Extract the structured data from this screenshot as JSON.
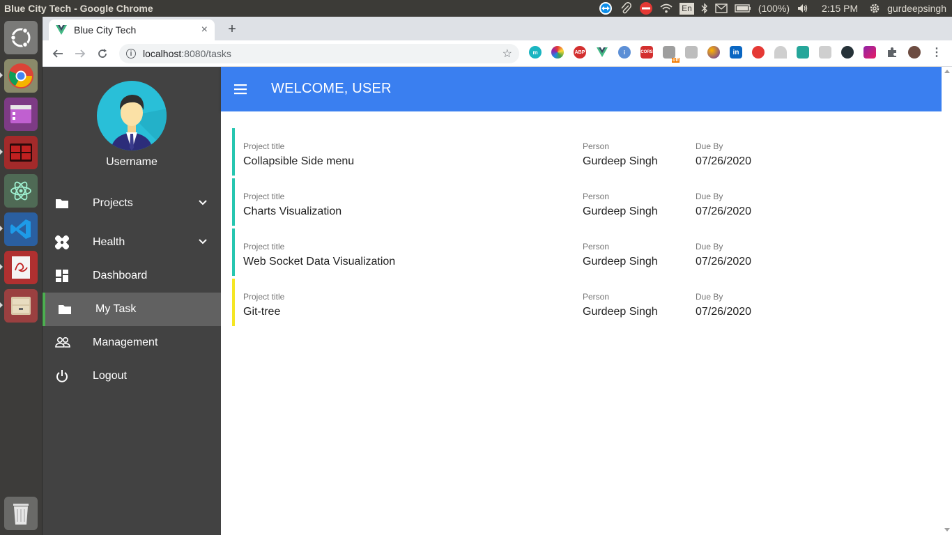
{
  "os": {
    "window_title": "Blue City Tech - Google Chrome",
    "tray": {
      "battery": "(100%)",
      "keyboard": "En",
      "time": "2:15 PM",
      "user": "gurdeepsingh"
    }
  },
  "browser": {
    "tab_title": "Blue City Tech",
    "tab_close": "×",
    "new_tab": "+",
    "url_host": "localhost",
    "url_path": ":8080/tasks",
    "extensions": [
      "m",
      "color",
      "ABP",
      "V",
      "info",
      "CORS",
      "off",
      "picker",
      "s",
      "in",
      "game",
      "arc",
      "shield",
      "rule",
      "eye",
      "pen",
      "puzzle",
      "avatar"
    ]
  },
  "app": {
    "header": {
      "welcome": "WELCOME, ",
      "user": "USER"
    },
    "profile": {
      "name": "Username"
    },
    "menu": [
      {
        "label": "Projects",
        "icon": "folder-icon",
        "expandable": true
      },
      {
        "label": "Health",
        "icon": "health-icon",
        "expandable": true
      },
      {
        "label": "Dashboard",
        "icon": "dashboard-icon",
        "expandable": false
      },
      {
        "label": "My Task",
        "icon": "folder-icon",
        "expandable": false,
        "active": true
      },
      {
        "label": "Management",
        "icon": "people-icon",
        "expandable": false
      },
      {
        "label": "Logout",
        "icon": "power-icon",
        "expandable": false
      }
    ],
    "task_labels": {
      "title": "Project title",
      "person": "Person",
      "due": "Due By"
    },
    "tasks": [
      {
        "title": "Collapsible Side menu",
        "person": "Gurdeep Singh",
        "due": "07/26/2020",
        "color": "#26c6b0"
      },
      {
        "title": "Charts Visualization",
        "person": "Gurdeep Singh",
        "due": "07/26/2020",
        "color": "#26c6b0"
      },
      {
        "title": "Web Socket Data Visualization",
        "person": "Gurdeep Singh",
        "due": "07/26/2020",
        "color": "#26c6b0"
      },
      {
        "title": "Git-tree",
        "person": "Gurdeep Singh",
        "due": "07/26/2020",
        "color": "#f5e623"
      }
    ]
  },
  "colors": {
    "appbar": "#3a7ff0",
    "sidebar": "#424242",
    "active_item": "#616161",
    "active_bar": "#4caf50"
  }
}
